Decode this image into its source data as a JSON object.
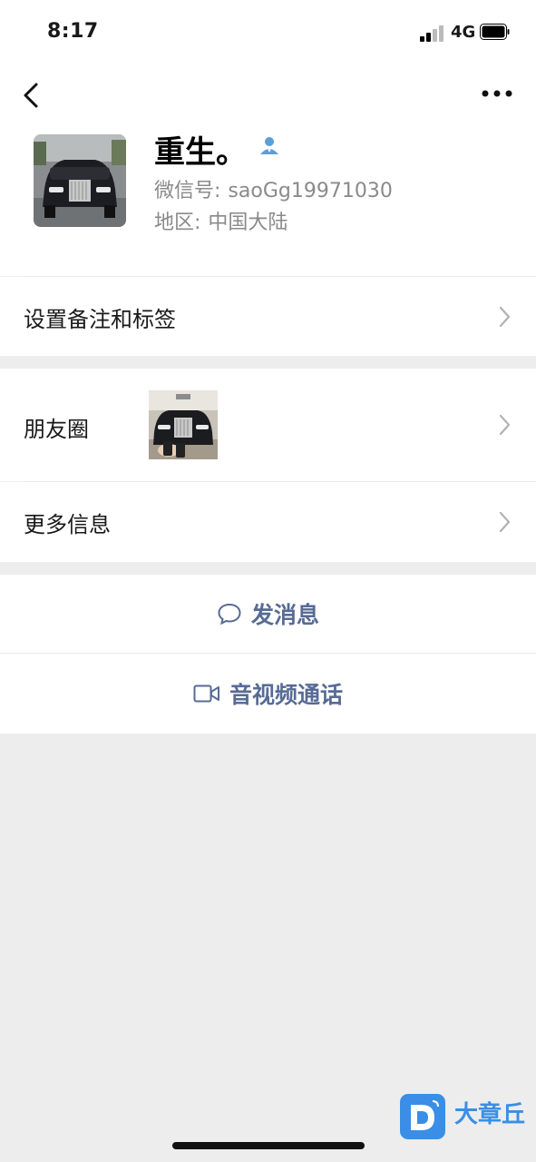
{
  "status_bar": {
    "time": "8:17",
    "network": "4G",
    "battery_icon": "battery-icon",
    "signal_icon": "signal-icon"
  },
  "nav": {
    "back_icon": "chevron-left-icon",
    "more_icon": "more-dots-icon"
  },
  "profile": {
    "name": "重生。",
    "wechat_id_label": "微信号:",
    "wechat_id": "saoGg19971030",
    "region_label": "地区:",
    "region": "中国大陆",
    "badge_icon": "contact-person-icon"
  },
  "rows": {
    "remark": "设置备注和标签",
    "moments": "朋友圈",
    "more_info": "更多信息"
  },
  "actions": {
    "message": "发消息",
    "message_icon": "chat-bubble-icon",
    "call": "音视频通话",
    "call_icon": "video-camera-icon"
  },
  "watermark": {
    "text": "大章丘"
  },
  "colors": {
    "link": "#576b95",
    "background": "#ededed",
    "watermark": "#3a8ee6"
  }
}
